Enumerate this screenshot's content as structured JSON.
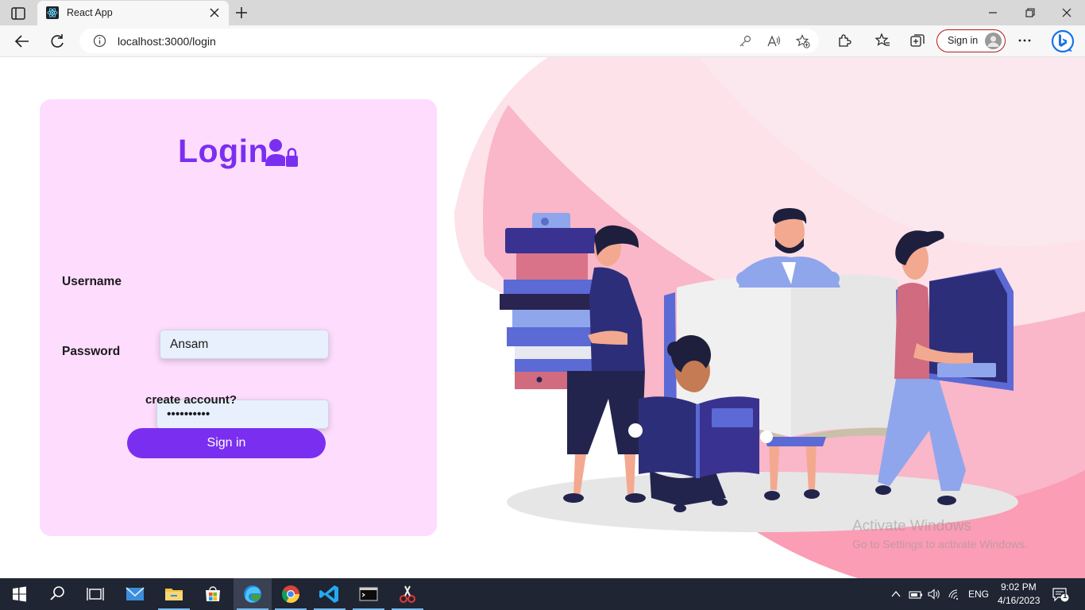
{
  "browser": {
    "tab_title": "React App",
    "url": "localhost:3000/login",
    "signin_label": "Sign in"
  },
  "login": {
    "title": "Login",
    "username_label": "Username",
    "username_value": "Ansam",
    "password_label": "Password",
    "password_value": "••••••••••",
    "create_account": "create account?",
    "signin_button": "Sign in",
    "accent_color": "#7a2ff0",
    "card_color": "#fedcfe"
  },
  "watermark": {
    "title": "Activate Windows",
    "subtitle": "Go to Settings to activate Windows."
  },
  "taskbar": {
    "apps": [
      "start-icon",
      "search-icon",
      "task-view-icon",
      "mail-icon",
      "file-explorer-icon",
      "store-icon",
      "edge-icon",
      "chrome-icon",
      "vscode-icon",
      "terminal-icon",
      "snipping-tool-icon"
    ],
    "language": "ENG",
    "time": "9:02 PM",
    "date": "4/16/2023",
    "notification_count": "1"
  }
}
